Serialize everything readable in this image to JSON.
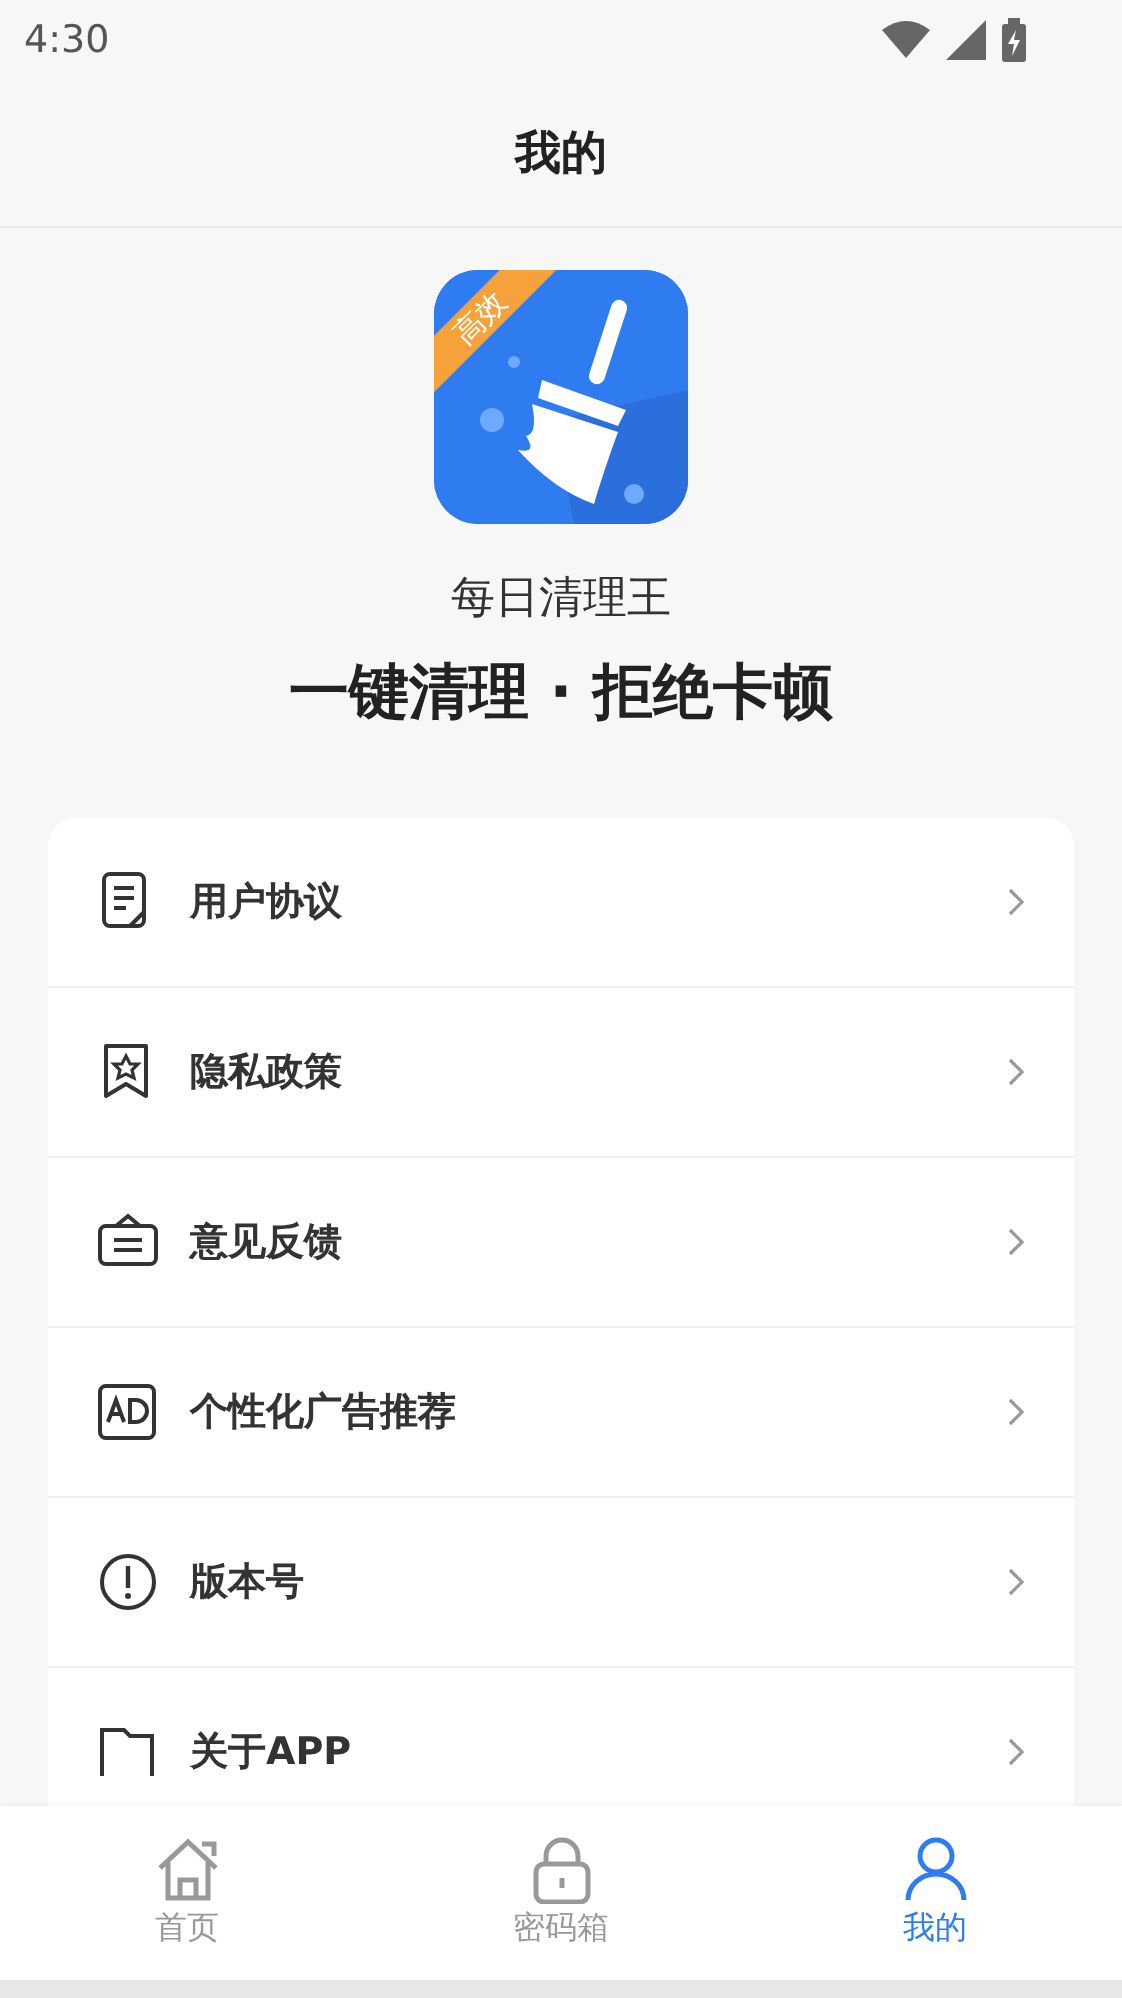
{
  "status_bar": {
    "time": "4:30"
  },
  "header": {
    "title": "我的"
  },
  "app": {
    "badge": "高效",
    "name": "每日清理王",
    "slogan": "一键清理 · 拒绝卡顿"
  },
  "menu": [
    {
      "kind": "document",
      "label": "用户协议"
    },
    {
      "kind": "bookmark",
      "label": "隐私政策"
    },
    {
      "kind": "feedback",
      "label": "意见反馈"
    },
    {
      "kind": "ad",
      "label": "个性化广告推荐"
    },
    {
      "kind": "info",
      "label": "版本号"
    },
    {
      "kind": "folder",
      "label": "关于APP"
    }
  ],
  "nav": [
    {
      "kind": "home",
      "label": "首页",
      "selected": false
    },
    {
      "kind": "lock",
      "label": "密码箱",
      "selected": false
    },
    {
      "kind": "person",
      "label": "我的",
      "selected": true
    }
  ]
}
